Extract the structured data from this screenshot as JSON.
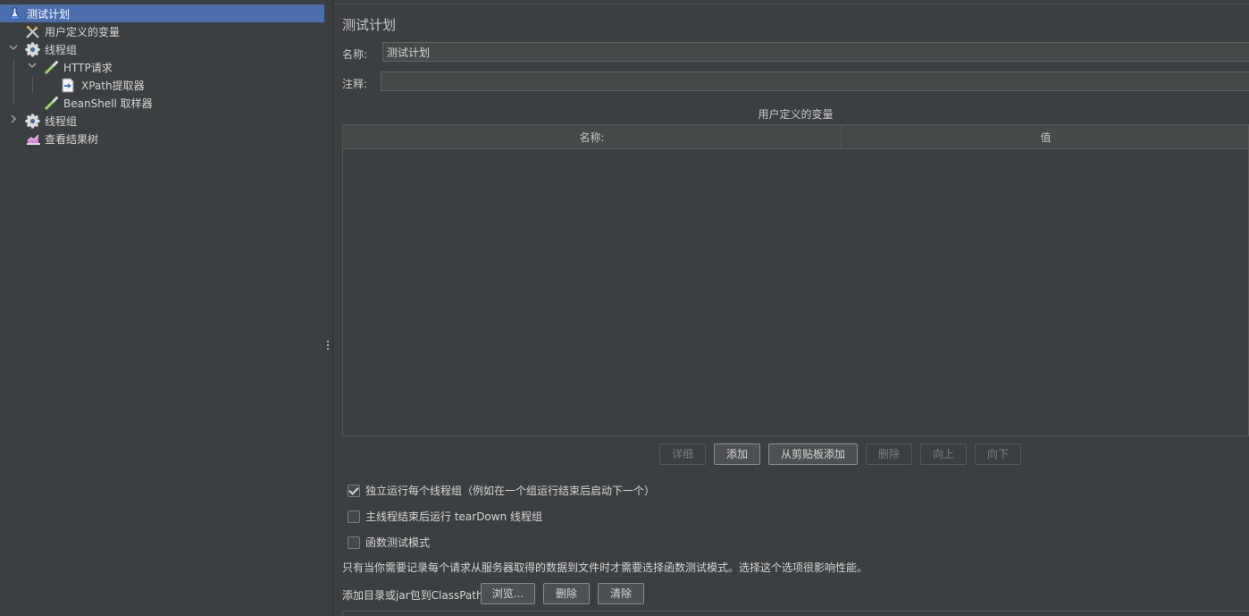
{
  "tree": {
    "items": [
      {
        "label": "测试计划",
        "icon": "test-plan-icon"
      },
      {
        "label": "用户定义的变量",
        "icon": "config-variables-icon"
      },
      {
        "label": "线程组",
        "icon": "gear-icon"
      },
      {
        "label": "HTTP请求",
        "icon": "pipette-sampler-icon"
      },
      {
        "label": "XPath提取器",
        "icon": "extractor-icon"
      },
      {
        "label": "BeanShell 取样器",
        "icon": "pipette-sampler-icon"
      },
      {
        "label": "线程组",
        "icon": "gear-icon"
      },
      {
        "label": "查看结果树",
        "icon": "listener-chart-icon"
      }
    ]
  },
  "panel": {
    "title": "测试计划",
    "name_label": "名称:",
    "name_value": "测试计划",
    "comment_label": "注释:",
    "comment_value": ""
  },
  "variables_table": {
    "caption": "用户定义的变量",
    "columns": [
      "名称:",
      "值"
    ],
    "rows": []
  },
  "table_buttons": {
    "detail": "详细",
    "add": "添加",
    "add_from_clipboard": "从剪贴板添加",
    "delete": "删除",
    "up": "向上",
    "down": "向下"
  },
  "options": {
    "run_independently": {
      "label": "独立运行每个线程组（例如在一个组运行结束后启动下一个）",
      "checked": true
    },
    "teardown_after_shutdown": {
      "label": "主线程结束后运行 tearDown 线程组",
      "checked": false
    },
    "functional_mode": {
      "label": "函数测试模式",
      "checked": false
    }
  },
  "functional_note": "只有当你需要记录每个请求从服务器取得的数据到文件时才需要选择函数测试模式。选择这个选项很影响性能。",
  "classpath": {
    "label": "添加目录或jar包到ClassPath",
    "browse": "浏览...",
    "delete": "删除",
    "clear": "清除"
  }
}
